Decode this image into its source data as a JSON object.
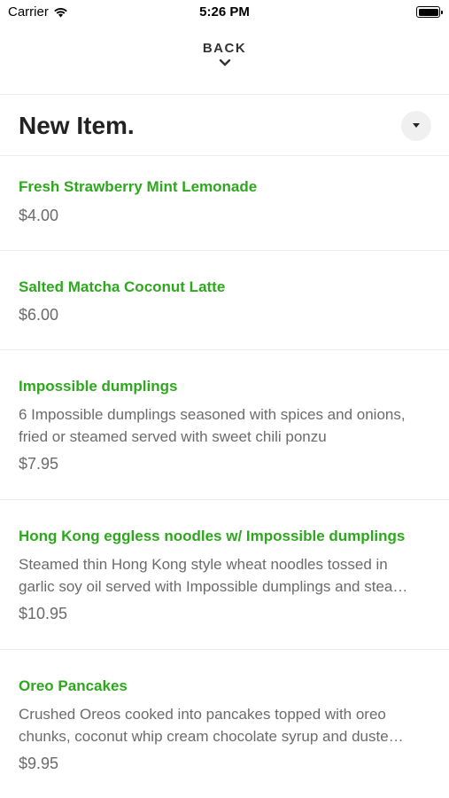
{
  "status_bar": {
    "carrier": "Carrier",
    "time": "5:26 PM"
  },
  "nav": {
    "back_label": "BACK"
  },
  "header": {
    "title": "New Item."
  },
  "items": [
    {
      "name": "Fresh Strawberry Mint Lemonade",
      "price": "$4.00"
    },
    {
      "name": "Salted Matcha Coconut Latte",
      "price": "$6.00"
    },
    {
      "name": "Impossible dumplings",
      "description": [
        "6 Impossible dumplings seasoned with spices and onions,",
        "fried or steamed served with sweet chili ponzu"
      ],
      "price": "$7.95"
    },
    {
      "name": "Hong Kong eggless noodles w/ Impossible dumplings",
      "description": [
        "Steamed thin Hong Kong style wheat noodles tossed in",
        "garlic soy oil served with Impossible dumplings and stea…"
      ],
      "price": "$10.95"
    },
    {
      "name": "Oreo Pancakes",
      "description": [
        "Crushed Oreos cooked into pancakes topped with oreo",
        "chunks, coconut whip cream  chocolate syrup and duste…"
      ],
      "price": "$9.95"
    }
  ],
  "colors": {
    "item_name": "#2da81d",
    "secondary_text": "#6b6b6b",
    "divider": "#ececec"
  },
  "icons": [
    "wifi-icon",
    "battery-icon",
    "chevron-down-icon",
    "caret-down-icon"
  ]
}
